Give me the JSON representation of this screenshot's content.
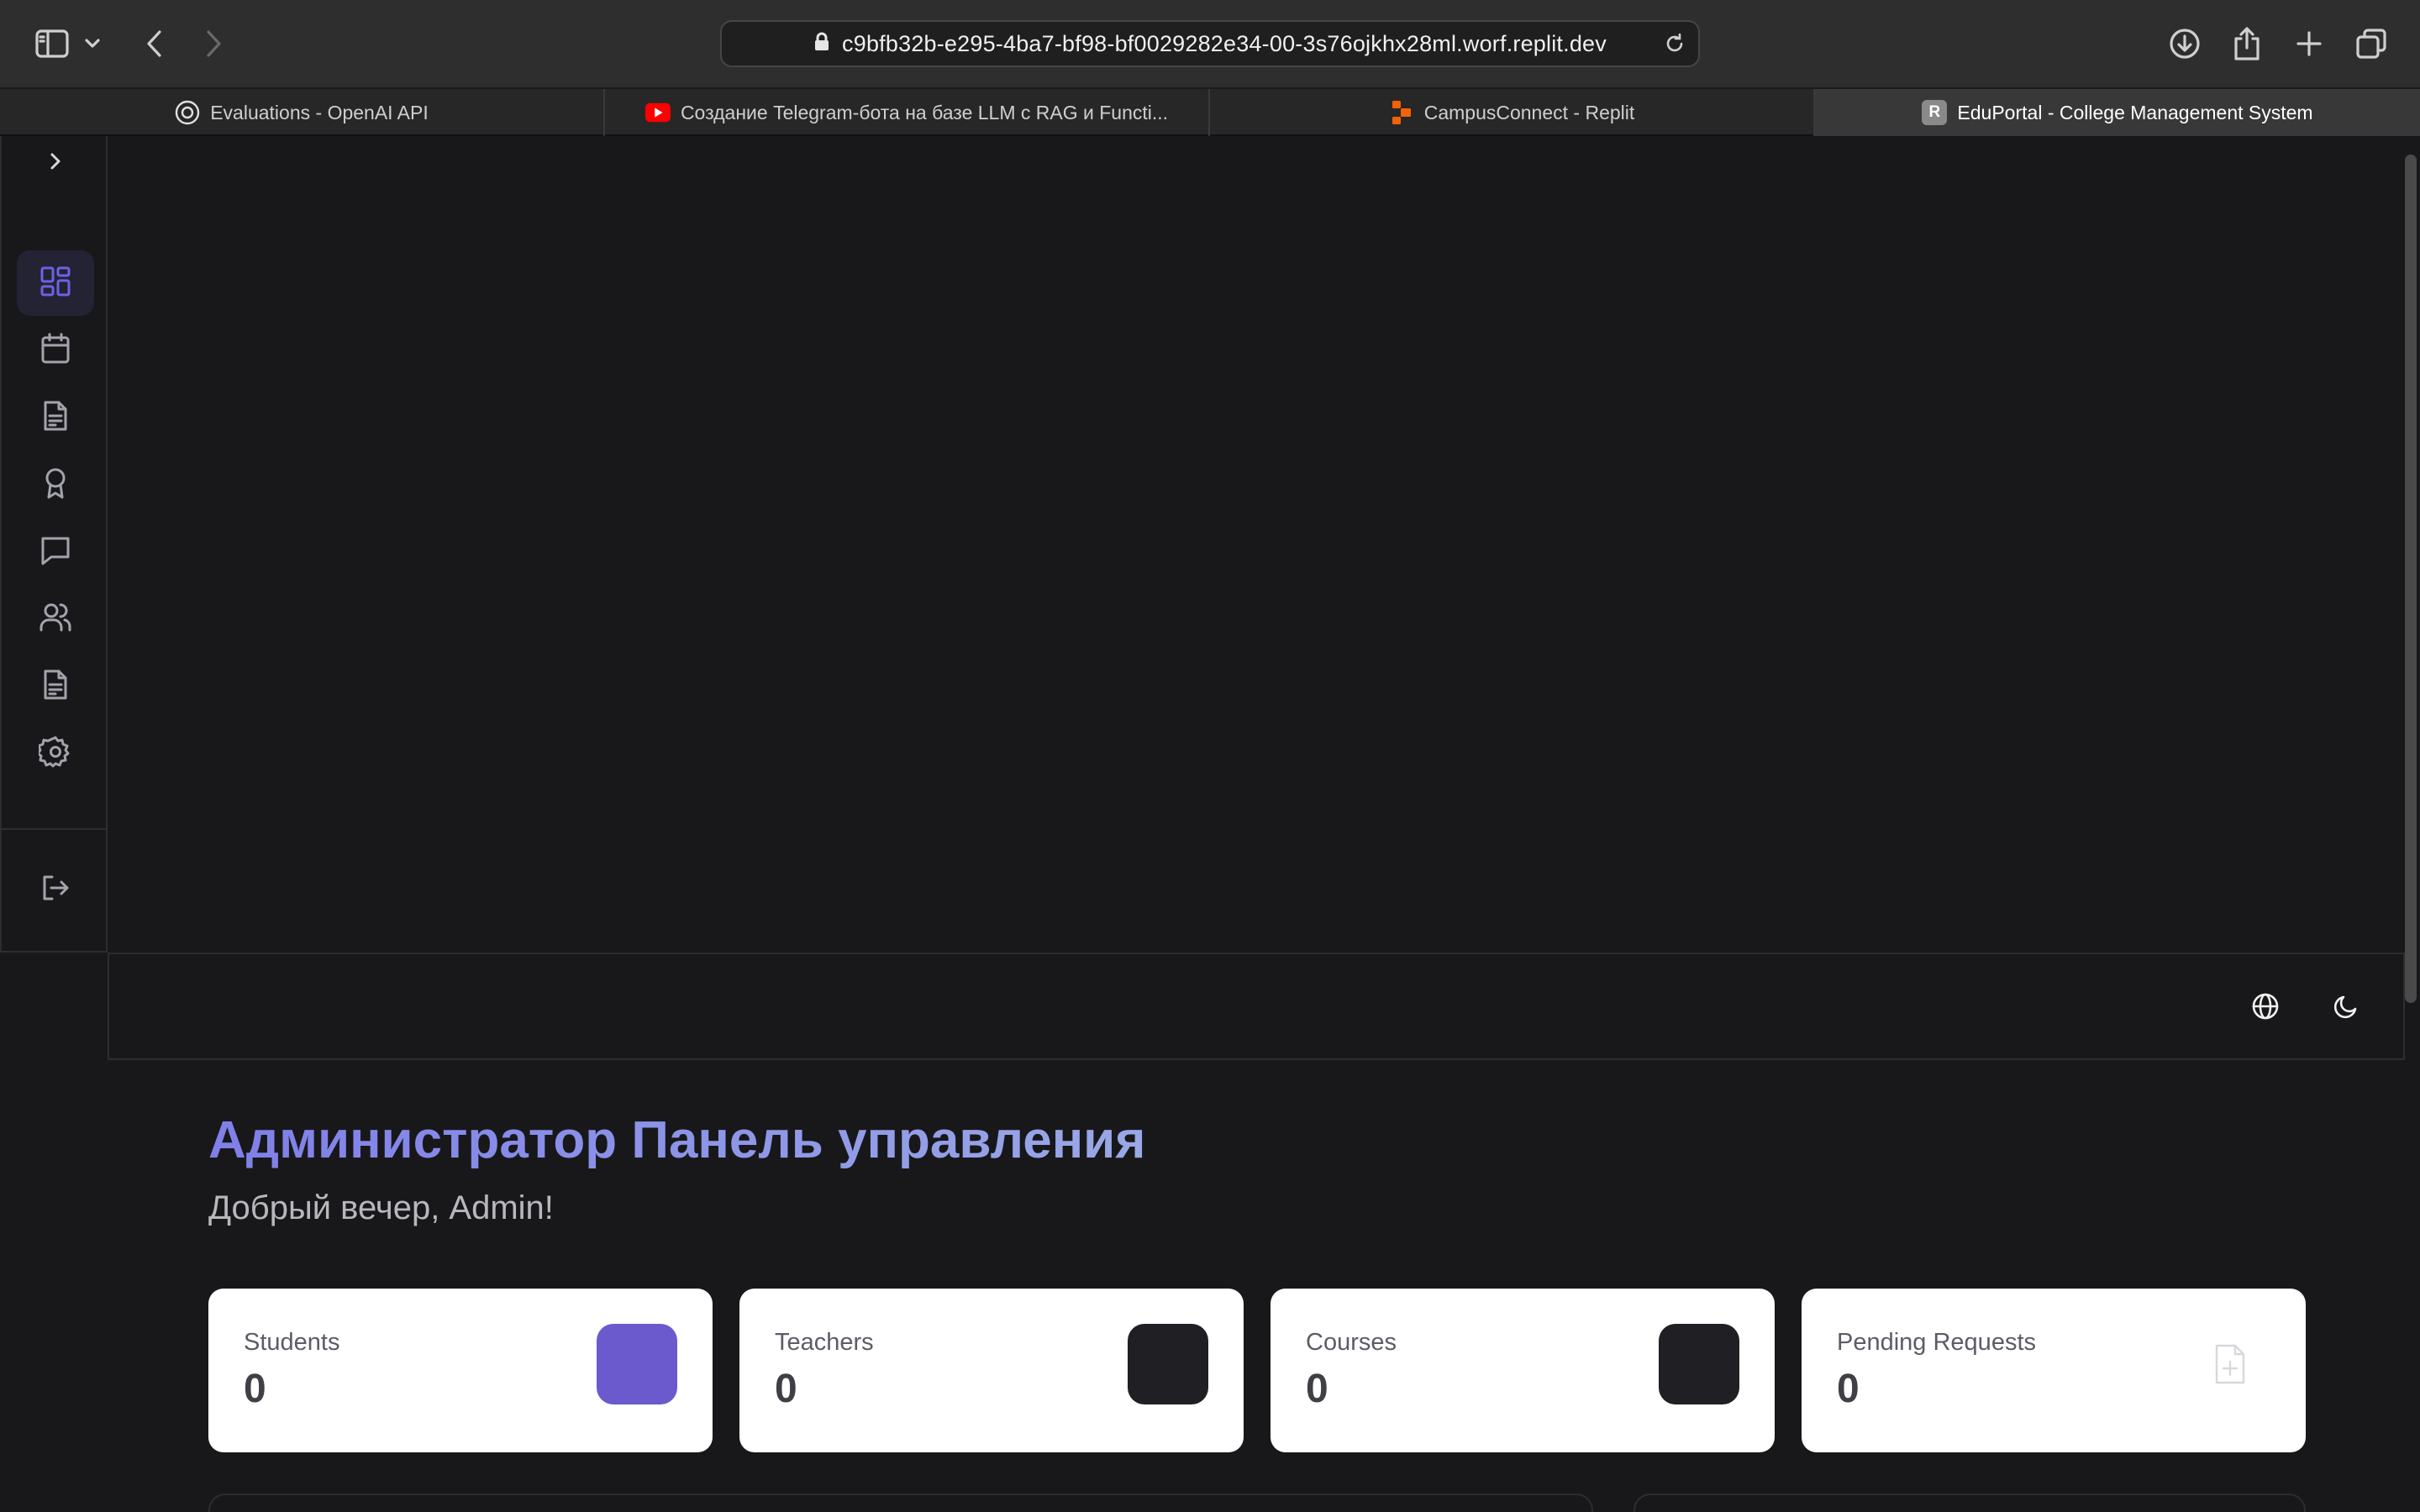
{
  "browser": {
    "url": "c9bfb32b-e295-4ba7-bf98-bf0029282e34-00-3s76ojkhx28ml.worf.replit.dev",
    "tabs": [
      {
        "label": "Evaluations - OpenAI API",
        "icon": "openai-icon"
      },
      {
        "label": "Создание Telegram-бота на базе LLM с RAG и Functi...",
        "icon": "youtube-icon"
      },
      {
        "label": "CampusConnect - Replit",
        "icon": "replit-icon"
      },
      {
        "label": "EduPortal - College Management System",
        "icon": "replit-r-icon",
        "favicon_letter": "R",
        "active": true
      }
    ]
  },
  "sidebar": {
    "items": [
      {
        "name": "dashboard",
        "icon": "dashboard-icon",
        "active": true
      },
      {
        "name": "schedule",
        "icon": "calendar-icon"
      },
      {
        "name": "documents",
        "icon": "document-icon"
      },
      {
        "name": "achievements",
        "icon": "award-icon"
      },
      {
        "name": "messages",
        "icon": "chat-icon"
      },
      {
        "name": "users",
        "icon": "users-icon"
      },
      {
        "name": "reports",
        "icon": "report-icon"
      },
      {
        "name": "settings",
        "icon": "gear-icon"
      }
    ],
    "logout_icon": "logout-icon"
  },
  "header": {
    "language_icon": "globe-icon",
    "theme_icon": "moon-icon"
  },
  "main": {
    "title": "Администратор Панель управления",
    "greeting": "Добрый вечер, Admin!",
    "stats": [
      {
        "label": "Students",
        "value": "0",
        "icon_color": "#6a5acd"
      },
      {
        "label": "Teachers",
        "value": "0",
        "icon_color": "#202024"
      },
      {
        "label": "Courses",
        "value": "0",
        "icon_color": "#202024"
      },
      {
        "label": "Pending Requests",
        "value": "0",
        "icon": "file-plus-icon"
      }
    ]
  },
  "colors": {
    "accent": "#6e62e5",
    "background": "#18181b",
    "card": "#ffffff"
  }
}
